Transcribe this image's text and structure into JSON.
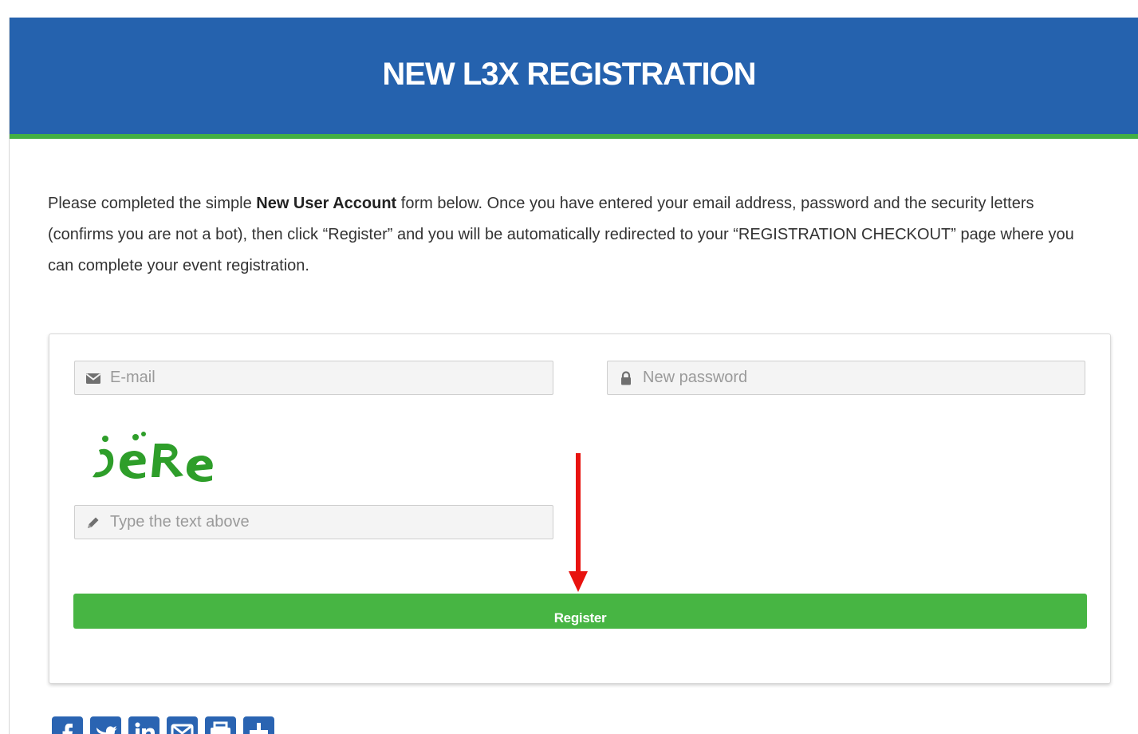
{
  "header": {
    "title": "NEW L3X REGISTRATION"
  },
  "intro": {
    "part1": "Please completed the simple ",
    "bold": "New User Account",
    "part2": " form below. Once you have entered your email address, password and the security letters (confirms you are not a bot), then click “Register” and you will be automatically redirected to your “REGISTRATION CHECKOUT” page where you can complete your event registration."
  },
  "form": {
    "email": {
      "placeholder": "E-mail",
      "value": "",
      "icon": "envelope-icon"
    },
    "password": {
      "placeholder": "New password",
      "value": "",
      "icon": "lock-icon"
    },
    "captcha": {
      "image_text": "jeRe",
      "placeholder": "Type the text above",
      "value": "",
      "icon": "pencil-icon"
    },
    "register_label": "Register"
  },
  "annotation": {
    "arrow_color": "#e8130f"
  },
  "share": {
    "buttons": [
      "facebook-icon",
      "twitter-icon",
      "linkedin-icon",
      "email-icon",
      "print-icon",
      "share-plus-icon"
    ]
  },
  "colors": {
    "header_bg": "#2562ae",
    "header_accent": "#43b043",
    "button_bg": "#47b543",
    "captcha_text": "#2e9e2a",
    "share_bg": "#2a64b2"
  }
}
